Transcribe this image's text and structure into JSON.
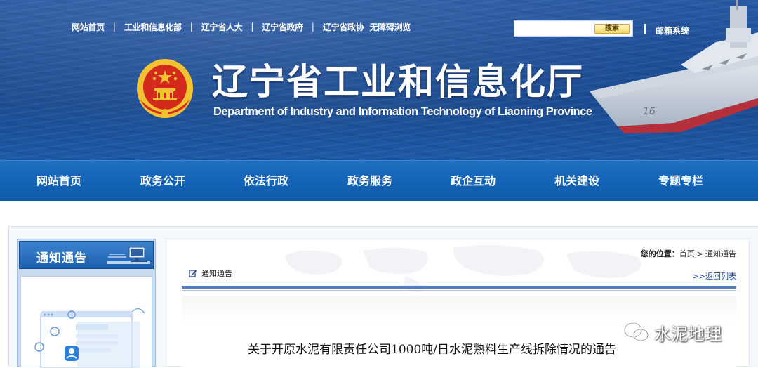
{
  "header": {
    "top_links": [
      "网站首页",
      "工业和信息化部",
      "辽宁省人大",
      "辽宁省政府",
      "辽宁省政协",
      "无障碍浏览"
    ],
    "search": {
      "placeholder": "",
      "button_label": "搜索"
    },
    "mail_link": "邮箱系统",
    "title_cn": "辽宁省工业和信息化厅",
    "title_en": "Department of Industry and Information Technology of Liaoning Province",
    "carrier_hull_number": "16"
  },
  "nav": {
    "items": [
      "网站首页",
      "政务公开",
      "依法行政",
      "政务服务",
      "政企互动",
      "机关建设",
      "专题专栏"
    ]
  },
  "sidebar": {
    "title": "通知通告"
  },
  "main": {
    "breadcrumb": {
      "label": "您的位置：",
      "home": "首页",
      "separator": ">",
      "current": "通知通告"
    },
    "section_title": "通知通告",
    "back_link": ">>返回列表",
    "article_title": "关于开原水泥有限责任公司1000吨/日水泥熟料生产线拆除情况的通告"
  },
  "watermark": {
    "text": "水泥地理"
  },
  "colors": {
    "banner_blue": "#1f4f97",
    "nav_blue": "#1464b7",
    "sidebar_head_blue": "#1d60ad",
    "emblem_red": "#d42a1c",
    "emblem_gold": "#f3c233"
  }
}
